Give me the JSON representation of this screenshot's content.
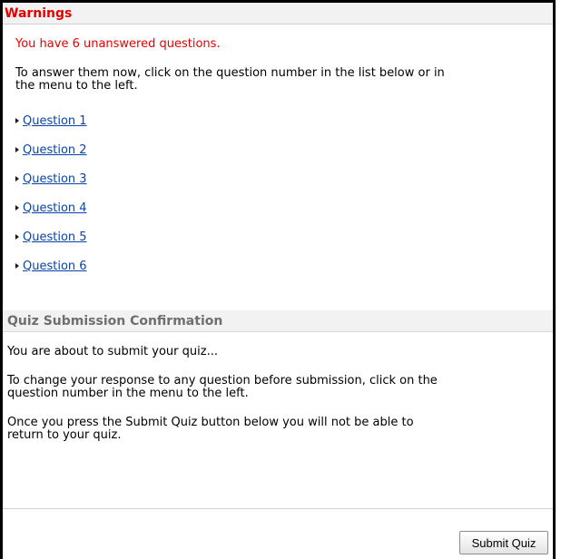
{
  "warnings": {
    "title": "Warnings",
    "unanswered_message": "You have 6 unanswered questions.",
    "instruction_line1": "To answer them now, click on the question number in the list below or in",
    "instruction_line2": "the menu to the left.",
    "questions": [
      {
        "label": "Question 1"
      },
      {
        "label": "Question 2"
      },
      {
        "label": "Question 3"
      },
      {
        "label": "Question 4"
      },
      {
        "label": "Question 5"
      },
      {
        "label": "Question 6"
      }
    ]
  },
  "confirmation": {
    "title": "Quiz Submission Confirmation",
    "about_to_submit": "You are about to submit your quiz...",
    "change_line1": "To change your response to any question before submission, click on the",
    "change_line2": "question number in the menu to the left.",
    "once_line1": "Once you press the Submit Quiz button below you will not be able to",
    "once_line2": "return to your quiz."
  },
  "actions": {
    "submit_label": "Submit Quiz"
  },
  "colors": {
    "warning_red": "#e60000",
    "link_blue": "#0645ad",
    "header_gray_text": "#6f6f6f"
  }
}
